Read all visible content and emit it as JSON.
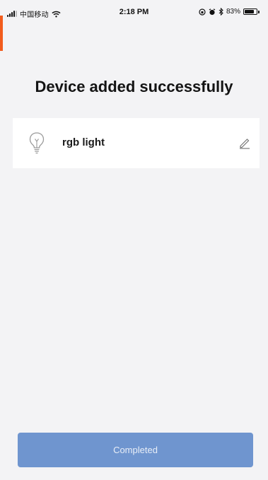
{
  "status_bar": {
    "carrier": "中国移动",
    "time": "2:18 PM",
    "battery_percent": "83%",
    "battery_level": 0.83,
    "icons": [
      "signal-icon",
      "wifi-icon",
      "orientation-lock-icon",
      "alarm-icon",
      "bluetooth-icon",
      "battery-icon"
    ]
  },
  "main": {
    "title": "Device added successfully",
    "device": {
      "name": "rgb light",
      "icon": "light-bulb-icon",
      "edit_icon": "pencil-icon"
    }
  },
  "footer": {
    "button_label": "Completed"
  },
  "colors": {
    "background": "#f3f3f5",
    "card": "#ffffff",
    "button": "#6f95cf",
    "button_text": "#e9eef7",
    "accent_edge": "#f25c1d"
  }
}
